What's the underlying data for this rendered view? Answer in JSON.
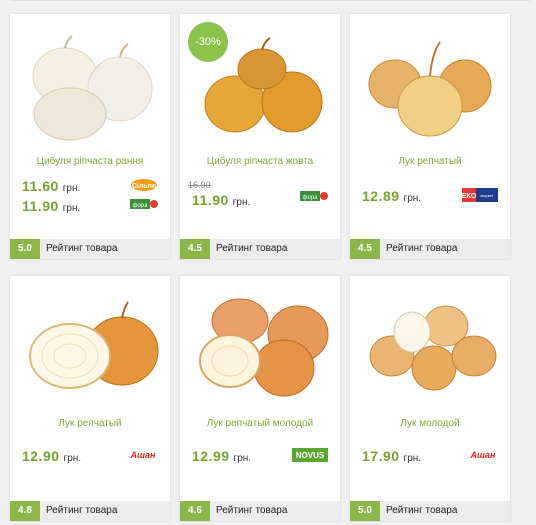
{
  "currency": "грн.",
  "rating_label": "Рейтинг товара",
  "products": [
    {
      "name": "Цибуля ріпчаста рання",
      "rating": "5.0",
      "prices": [
        {
          "value": "11.60",
          "store": "Сільпо"
        },
        {
          "value": "11.90",
          "store": "Фора"
        }
      ]
    },
    {
      "name": "Цибуля ріпчаста жовта",
      "rating": "4.5",
      "discount": "-30%",
      "old_price": "16.90",
      "prices": [
        {
          "value": "11.90",
          "store": "Фора"
        }
      ]
    },
    {
      "name": "Лук репчатый",
      "rating": "4.5",
      "prices": [
        {
          "value": "12.89",
          "store": "ЕКО маркет"
        }
      ]
    },
    {
      "name": "Лук репчатый",
      "rating": "4.8",
      "prices": [
        {
          "value": "12.90",
          "store": "Ашан"
        }
      ]
    },
    {
      "name": "Лук репчатый молодой",
      "rating": "4.6",
      "prices": [
        {
          "value": "12.99",
          "store": "NOVUS"
        }
      ]
    },
    {
      "name": "Лук молодой",
      "rating": "5.0",
      "prices": [
        {
          "value": "17.90",
          "store": "Ашан"
        }
      ]
    }
  ],
  "colors": {
    "accent_green": "#76a22a",
    "rating_green": "#8ab64a",
    "onion_gold": "#d79a3a"
  }
}
